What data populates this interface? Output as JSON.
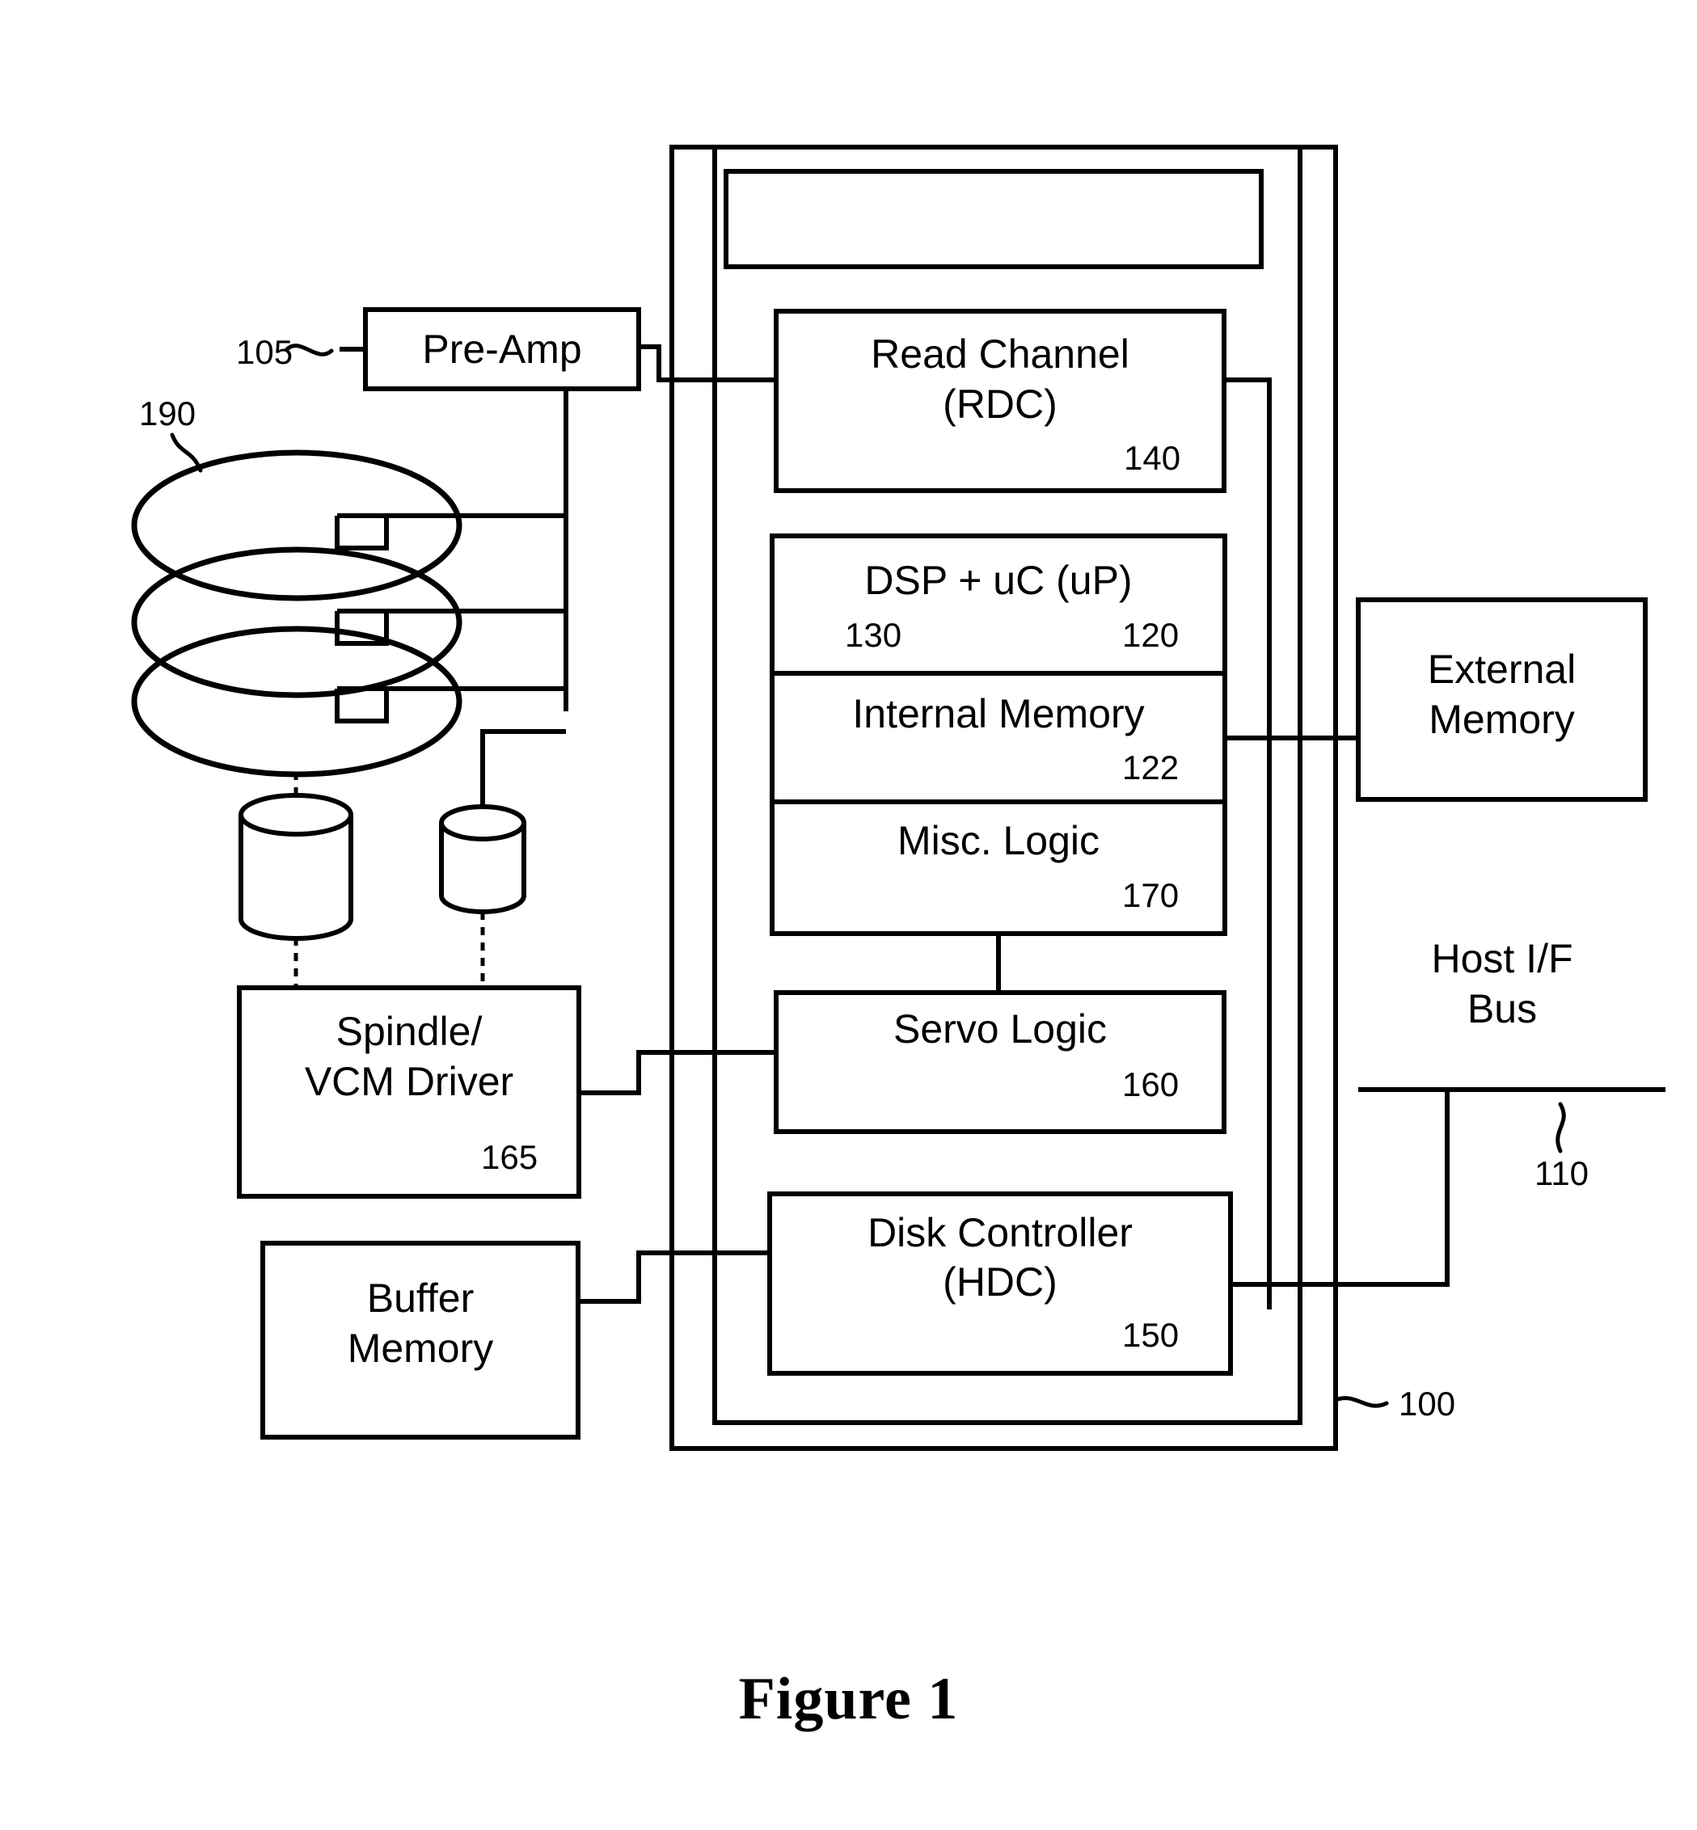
{
  "figure": {
    "caption": "Figure 1",
    "type": "hard-disk-drive-block-diagram"
  },
  "reference_numerals": {
    "preamp": "105",
    "disks": "190",
    "system": "100",
    "host_bus": "110",
    "read_channel": "140",
    "dsp": "130",
    "microcontroller": "120",
    "internal_memory": "122",
    "misc_logic": "170",
    "servo_logic": "160",
    "disk_controller": "150",
    "spindle_vcm_driver": "165"
  },
  "blocks": {
    "preamp": {
      "label": "Pre-Amp"
    },
    "read_channel": {
      "line1": "Read Channel",
      "line2": "(RDC)",
      "num": "140"
    },
    "dsp_uc": {
      "label": "DSP + uC (uP)",
      "num_left": "130",
      "num_right": "120"
    },
    "internal_memory": {
      "label": "Internal Memory",
      "num": "122"
    },
    "misc_logic": {
      "label": "Misc. Logic",
      "num": "170"
    },
    "servo_logic": {
      "label": "Servo Logic",
      "num": "160"
    },
    "disk_controller": {
      "line1": "Disk Controller",
      "line2": "(HDC)",
      "num": "150"
    },
    "spindle_vcm": {
      "line1": "Spindle/",
      "line2": "VCM Driver",
      "num": "165"
    },
    "buffer_memory": {
      "line1": "Buffer",
      "line2": "Memory"
    },
    "external_memory": {
      "line1": "External",
      "line2": "Memory"
    },
    "empty_top_box": {
      "label": ""
    }
  },
  "annotations": {
    "host_if_bus": {
      "line1": "Host I/F",
      "line2": "Bus"
    },
    "preamp_ref": "105",
    "disks_ref": "190",
    "system_ref": "100",
    "host_bus_ref": "110"
  },
  "colors": {
    "ink": "#000000",
    "paper": "#ffffff"
  }
}
